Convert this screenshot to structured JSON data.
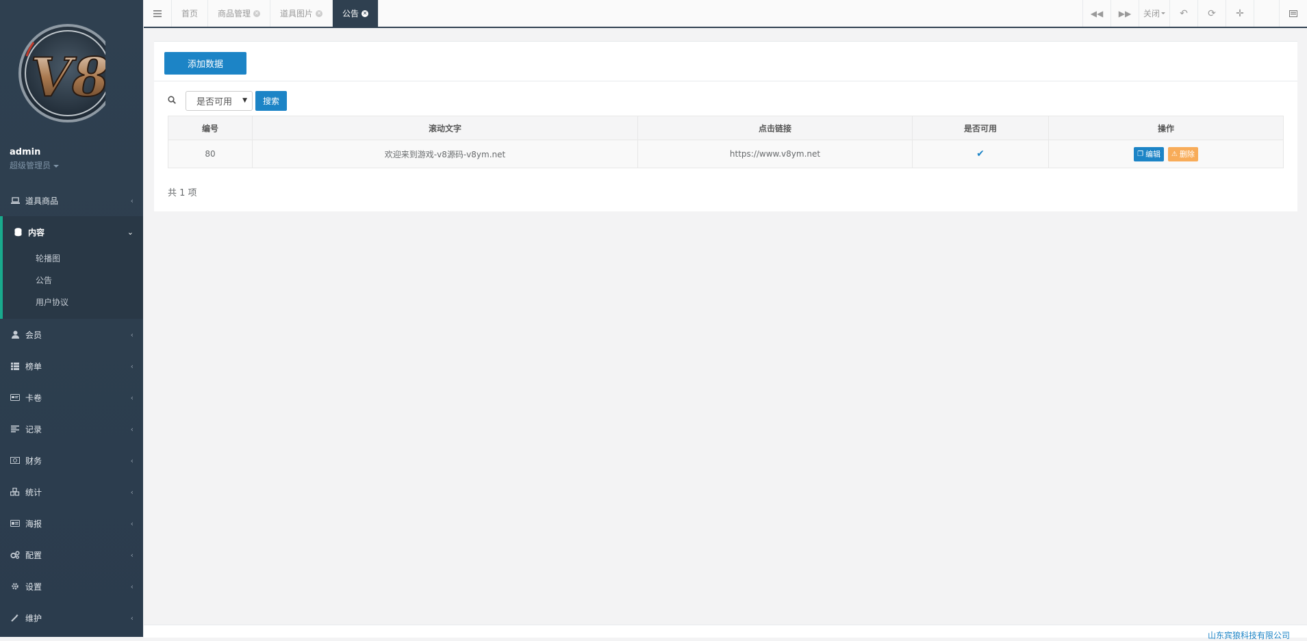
{
  "sidebar": {
    "logo_text": "V8",
    "user_name": "admin",
    "user_role": "超级管理员",
    "menu": [
      {
        "label": "道具商品",
        "icon": "laptop-icon"
      },
      {
        "label": "内容",
        "icon": "database-icon",
        "open": true,
        "children": [
          "轮播图",
          "公告",
          "用户协议"
        ]
      },
      {
        "label": "会员",
        "icon": "user-icon"
      },
      {
        "label": "榜单",
        "icon": "list-icon"
      },
      {
        "label": "卡卷",
        "icon": "card-icon"
      },
      {
        "label": "记录",
        "icon": "align-left-icon"
      },
      {
        "label": "财务",
        "icon": "money-icon"
      },
      {
        "label": "统计",
        "icon": "cubes-icon"
      },
      {
        "label": "海报",
        "icon": "image-card-icon"
      },
      {
        "label": "配置",
        "icon": "cogs-icon"
      },
      {
        "label": "设置",
        "icon": "gear-icon"
      },
      {
        "label": "维护",
        "icon": "magic-wand-icon"
      }
    ]
  },
  "tabs": {
    "items": [
      {
        "label": "首页",
        "closable": false
      },
      {
        "label": "商品管理",
        "closable": true
      },
      {
        "label": "道具图片",
        "closable": true
      },
      {
        "label": "公告",
        "closable": true,
        "active": true
      }
    ],
    "close_label": "关闭"
  },
  "main": {
    "add_button": "添加数据",
    "filter_select": "是否可用",
    "search_button": "搜索",
    "table": {
      "headers": [
        "编号",
        "滚动文字",
        "点击链接",
        "是否可用",
        "操作"
      ],
      "rows": [
        {
          "id": "80",
          "text": "欢迎来到游戏-v8源码-v8ym.net",
          "link": "https://www.v8ym.net",
          "enabled": true
        }
      ],
      "edit_label": "编辑",
      "delete_label": "删除"
    },
    "total": "共 1 项"
  },
  "footer": {
    "company": "山东宾狼科技有限公司"
  },
  "colors": {
    "sidebar": "#2f4050",
    "primary": "#1c84c6",
    "warning": "#f8ac59",
    "accent": "#19aa8d"
  }
}
